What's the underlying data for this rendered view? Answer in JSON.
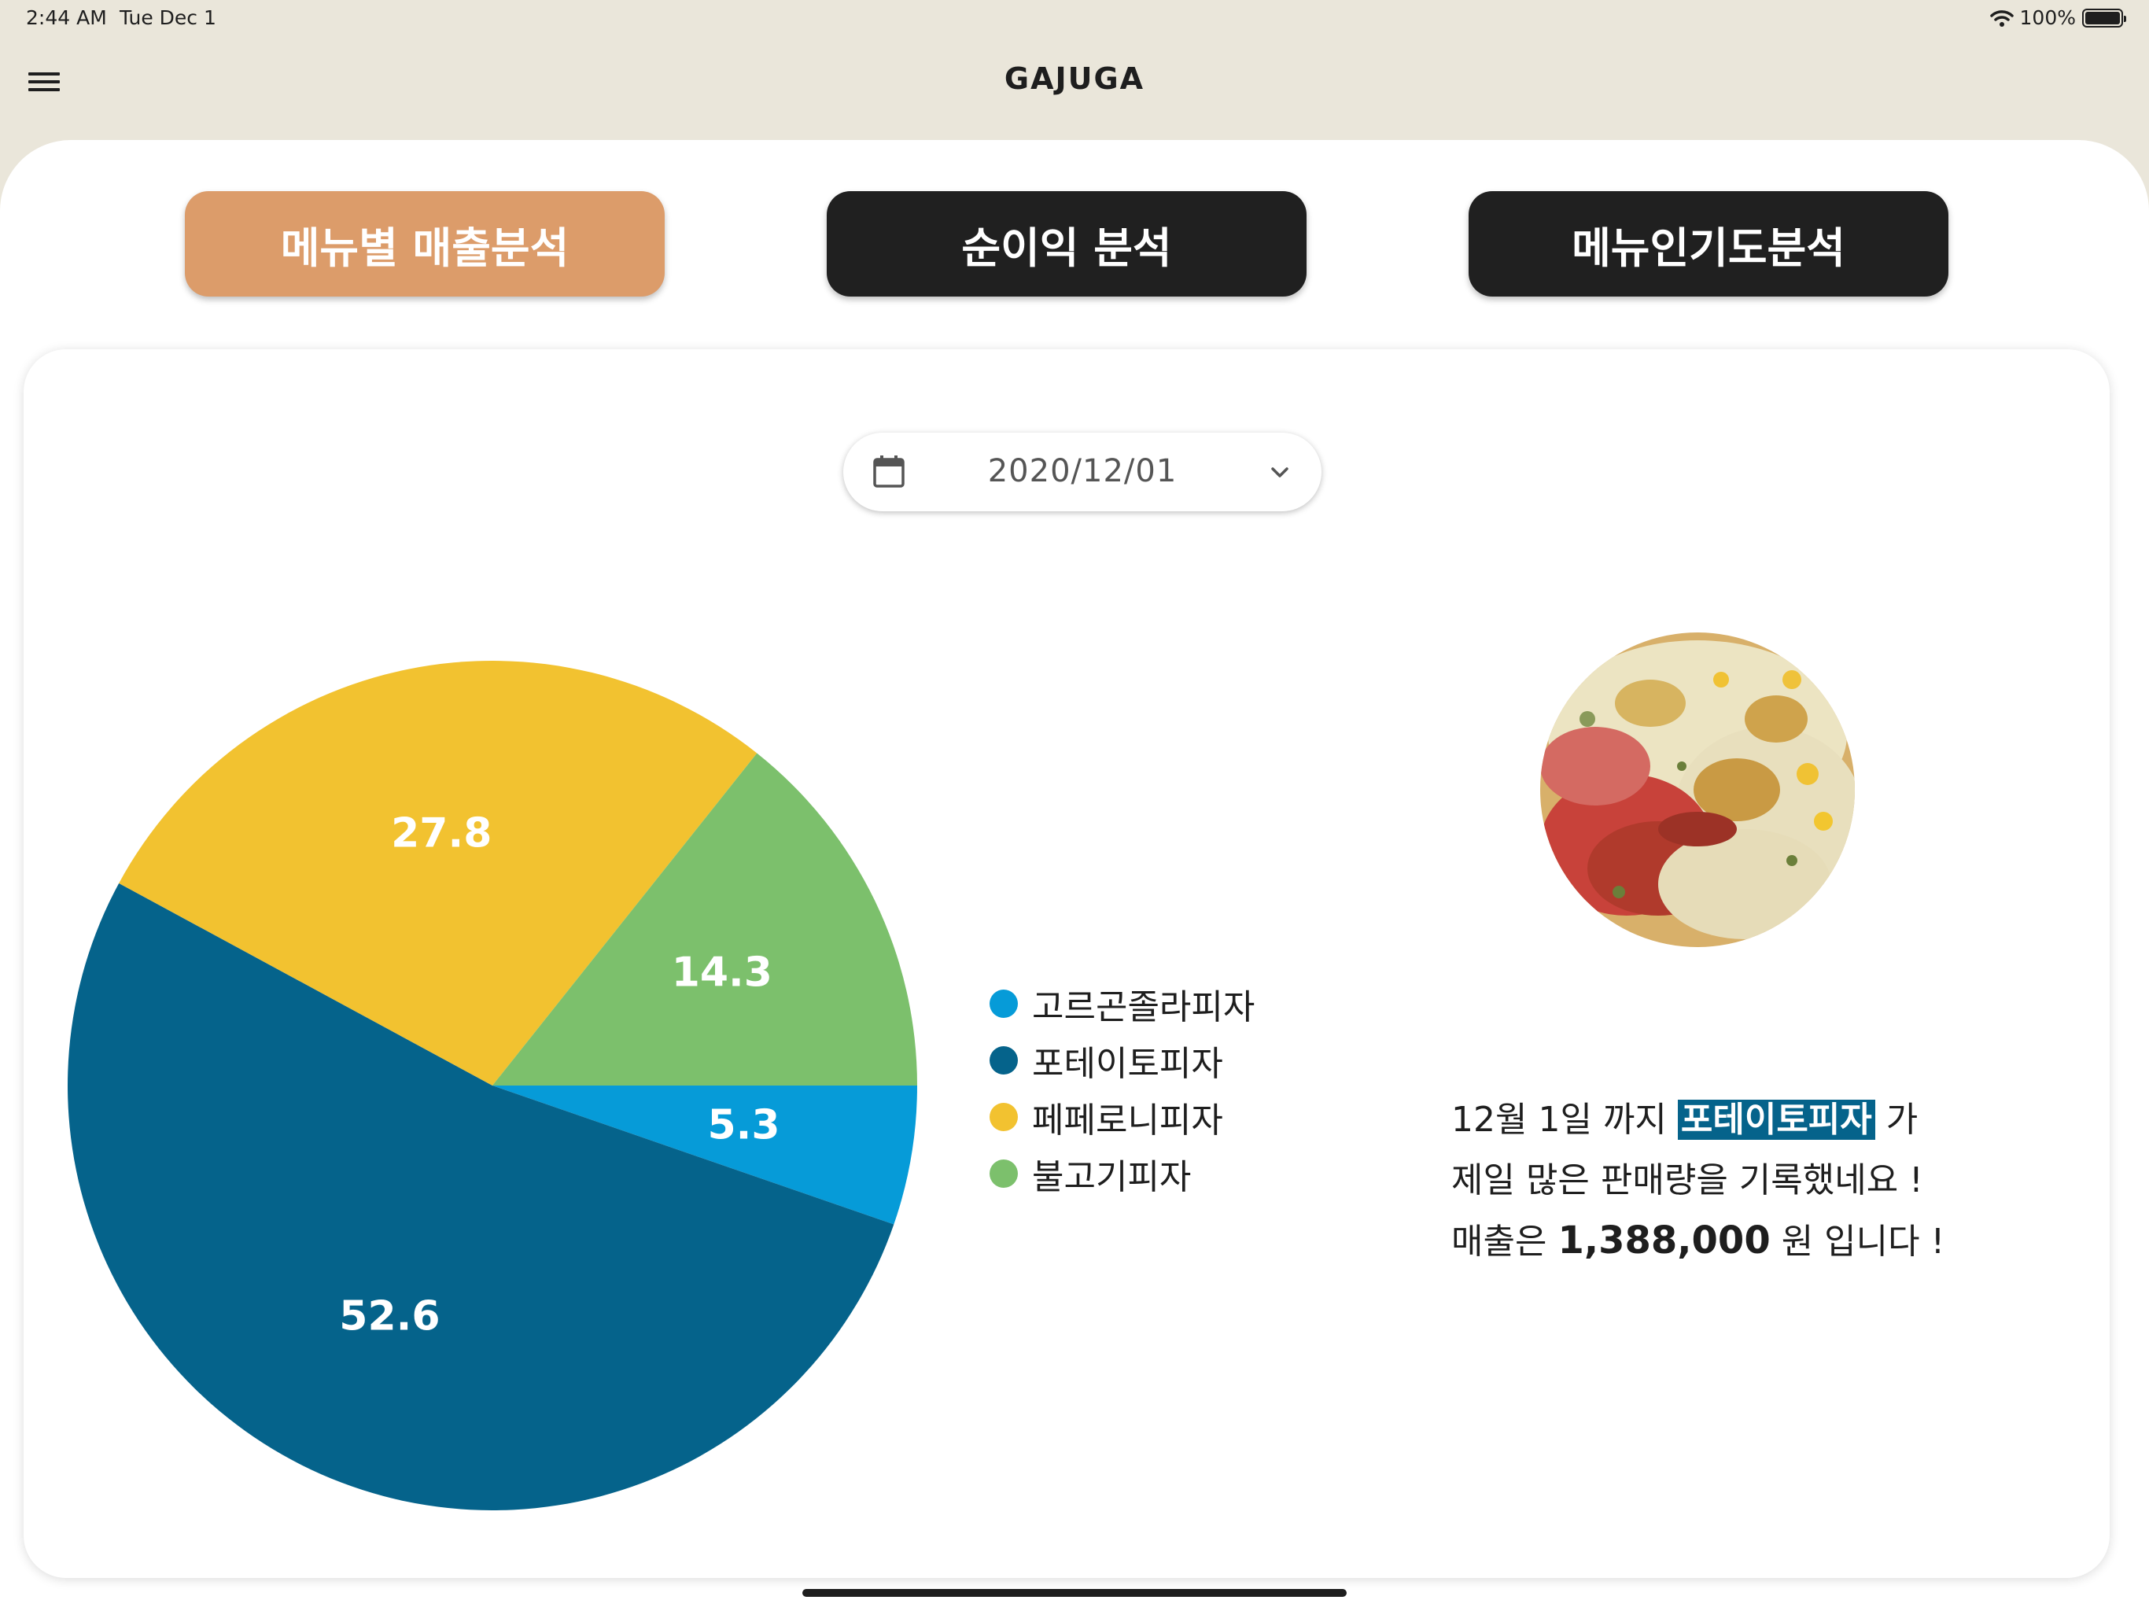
{
  "status_bar": {
    "time": "2:44 AM",
    "date": "Tue Dec 1",
    "battery": "100%"
  },
  "app_bar": {
    "title": "GAJUGA",
    "menu_icon": "hamburger-menu-icon"
  },
  "tabs": [
    {
      "label": "메뉴별 매출분석",
      "active": true,
      "color": "#dc9c6a"
    },
    {
      "label": "순이익 분석",
      "active": false,
      "color": "#202020"
    },
    {
      "label": "메뉴인기도분석",
      "active": false,
      "color": "#202020"
    }
  ],
  "date_picker": {
    "value": "2020/12/01",
    "icon": "calendar-icon",
    "dropdown_icon": "chevron-down-icon"
  },
  "chart_data": {
    "type": "pie",
    "categories": [
      "고르곤졸라피자",
      "포테이토피자",
      "페페로니피자",
      "불고기피자"
    ],
    "values": [
      5.3,
      52.6,
      27.8,
      14.3
    ],
    "colors": [
      "#069bd8",
      "#05638b",
      "#f2c230",
      "#7cc06c"
    ],
    "legend_position": "right"
  },
  "summary": {
    "line1_prefix": "12월 1일 까지",
    "highlight_menu": "포테이토피자",
    "line1_suffix": "가",
    "line2": "제일 많은 판매량을 기록했네요 !",
    "line3_prefix": "매출은",
    "amount": "1,388,000",
    "line3_suffix": "원 입니다 !"
  },
  "image": {
    "subject": "pizza-photo"
  }
}
